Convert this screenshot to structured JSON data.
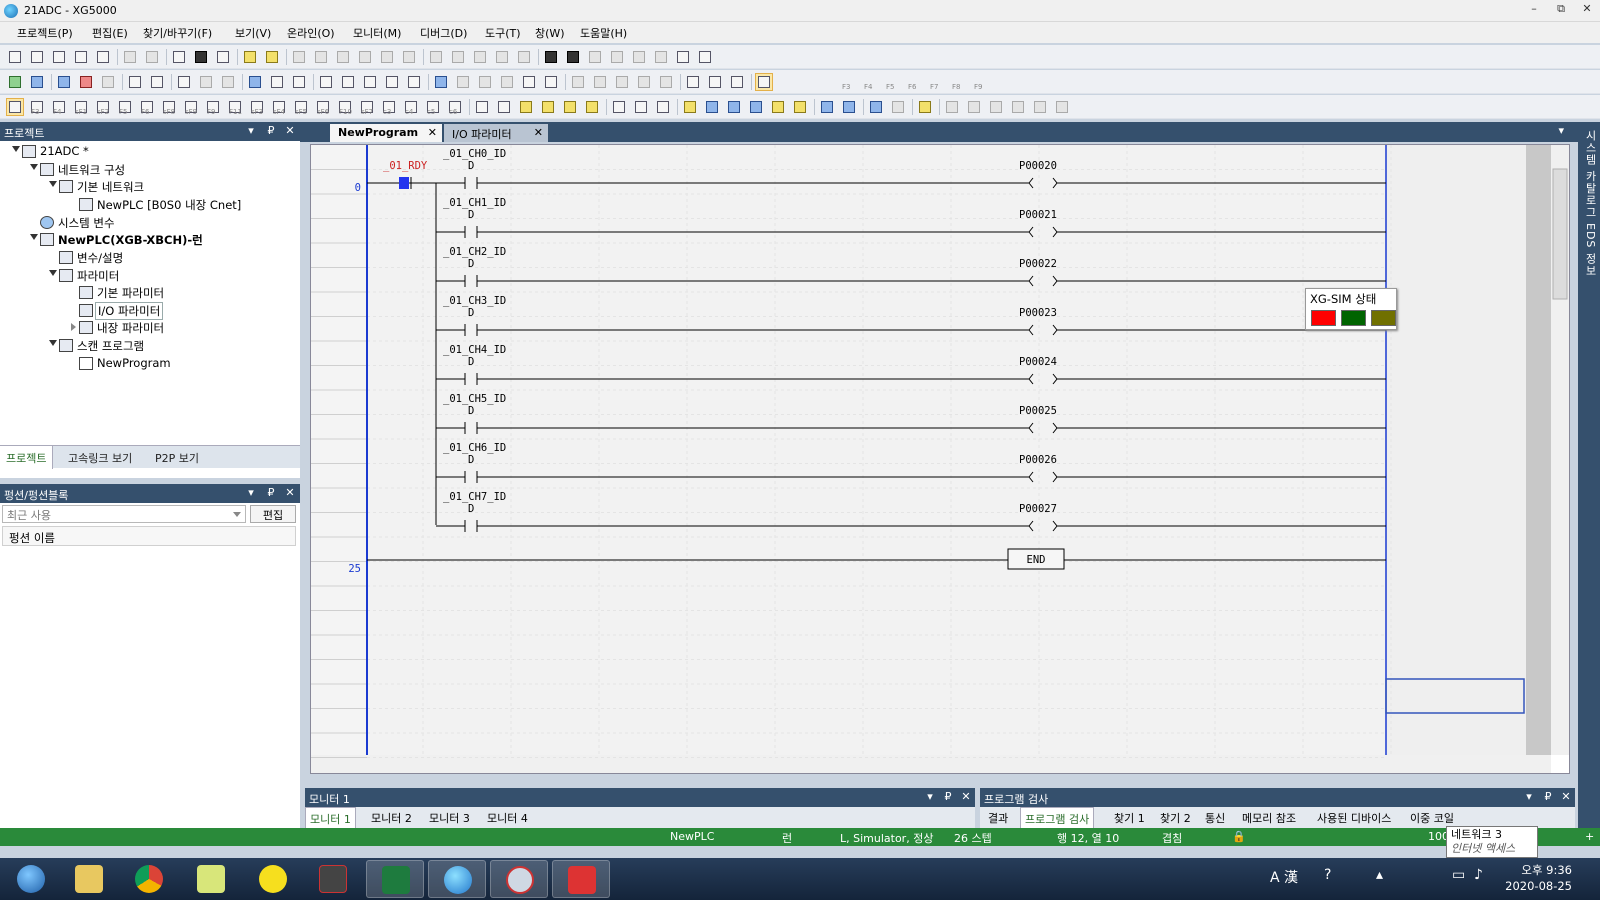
{
  "window": {
    "title": "21ADC - XG5000",
    "minimize": "–",
    "restore": "⧉",
    "close": "✕"
  },
  "menu": [
    "프로젝트(P)",
    "편집(E)",
    "찾기/바꾸기(F)",
    "보기(V)",
    "온라인(O)",
    "모니터(M)",
    "디버그(D)",
    "도구(T)",
    "창(W)",
    "도움말(H)"
  ],
  "toolbar3_labels": [
    "F3",
    "F4",
    "sF1",
    "sF2",
    "F5",
    "F6",
    "sF8",
    "sF9",
    "F9",
    "F11",
    "sF3",
    "sF4",
    "sF5",
    "sF6",
    "F10",
    "sF7",
    "c3",
    "c4",
    "c5",
    "c6"
  ],
  "fkeys2": [
    "F3",
    "F4",
    "F5",
    "F6",
    "F7",
    "F8",
    "F9"
  ],
  "project_panel": {
    "title": "프로젝트",
    "tree": [
      {
        "label": "21ADC *"
      },
      {
        "label": "네트워크 구성"
      },
      {
        "label": "기본 네트워크"
      },
      {
        "label": "NewPLC [B0S0 내장 Cnet]"
      },
      {
        "label": "시스템 변수"
      },
      {
        "label": "NewPLC(XGB-XBCH)-런"
      },
      {
        "label": "변수/설명"
      },
      {
        "label": "파라미터"
      },
      {
        "label": "기본 파라미터"
      },
      {
        "label": "I/O 파라미터"
      },
      {
        "label": "내장 파라미터"
      },
      {
        "label": "스캔 프로그램"
      },
      {
        "label": "NewProgram"
      }
    ],
    "tabs": [
      "프로젝트",
      "고속링크 보기",
      "P2P 보기"
    ]
  },
  "function_panel": {
    "title": "펑션/펑션블록",
    "select_value": "최근 사용",
    "edit_button": "편집",
    "column_header": "펑션 이름"
  },
  "doc_tabs": [
    {
      "label": "NewProgram"
    },
    {
      "label": "I/O 파라미터"
    }
  ],
  "ladder": {
    "step_labels": [
      "0",
      "25"
    ],
    "start_contact": "_01_RDY",
    "rungs": [
      {
        "contact": "_01_CH0_ID",
        "contact2": "D",
        "coil": "P00020"
      },
      {
        "contact": "_01_CH1_ID",
        "contact2": "D",
        "coil": "P00021"
      },
      {
        "contact": "_01_CH2_ID",
        "contact2": "D",
        "coil": "P00022"
      },
      {
        "contact": "_01_CH3_ID",
        "contact2": "D",
        "coil": "P00023"
      },
      {
        "contact": "_01_CH4_ID",
        "contact2": "D",
        "coil": "P00024"
      },
      {
        "contact": "_01_CH5_ID",
        "contact2": "D",
        "coil": "P00025"
      },
      {
        "contact": "_01_CH6_ID",
        "contact2": "D",
        "coil": "P00026"
      },
      {
        "contact": "_01_CH7_ID",
        "contact2": "D",
        "coil": "P00027"
      }
    ],
    "end_label": "END"
  },
  "right_sidebar": {
    "label": "시스템 카탈로그 EDS 정보"
  },
  "xgsim": {
    "title": "XG-SIM 상태",
    "colors": [
      "#ff0000",
      "#006400",
      "#707000"
    ]
  },
  "monitor_panel": {
    "title": "모니터 1",
    "tabs": [
      "모니터 1",
      "모니터 2",
      "모니터 3",
      "모니터 4"
    ]
  },
  "check_panel": {
    "title": "프로그램 검사",
    "tabs": [
      "결과",
      "프로그램 검사",
      "찾기 1",
      "찾기 2",
      "통신",
      "메모리 참조",
      "사용된 디바이스",
      "이중 코일"
    ]
  },
  "status": {
    "plc": "NewPLC",
    "mode": "런",
    "connection": "L, Simulator, 정상",
    "steps": "26 스텝",
    "position": "행 12, 열 10",
    "insert_mode": "겹침",
    "zoom": "100"
  },
  "tooltip": {
    "line1": "네트워크 3",
    "line2": "인터넷 액세스"
  },
  "taskbar": {
    "time": "오후 9:36",
    "date": "2020-08-25",
    "ime": "A 漢",
    "apps": [
      "file-explorer",
      "chrome",
      "notes",
      "kakaotalk",
      "file-manager",
      "excel",
      "xg5000",
      "xgsim",
      "pdf"
    ]
  },
  "colors": {
    "panel_header": "#35506d",
    "status_bar": "#2a8a3a",
    "rail": "#1a3ad1",
    "contact_label": "#cc2222"
  }
}
